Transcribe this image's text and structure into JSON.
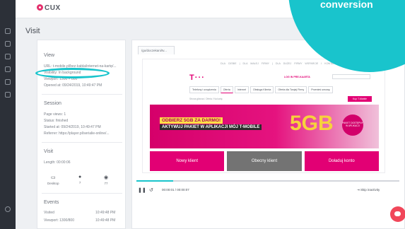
{
  "app": {
    "logo_text": "CUX"
  },
  "page": {
    "title": "Visit"
  },
  "view": {
    "heading": "View",
    "url": "URL: t-mobile.pl/bez-kabla/internet-na-kartę/...",
    "visibility": "Visibility: In background",
    "viewport": "Viewport: 1300 × 800",
    "opened_at": "Opened at: 09/24/2019, 10:49:47 PM"
  },
  "session": {
    "heading": "Session",
    "page_views": "Page views: 1",
    "status": "Status: finished",
    "started_at": "Started at: 09/24/2019, 10:49:47 PM",
    "referrer": "Referrer: https://player.pl/serialie-online/..."
  },
  "visit": {
    "heading": "Visit",
    "length": "Length: 00:00:06",
    "devices": [
      {
        "icon": "desktop-icon",
        "label": "Desktop"
      },
      {
        "icon": "apple-icon",
        "label": "7"
      },
      {
        "icon": "chrome-icon",
        "label": "77"
      }
    ]
  },
  "events": {
    "heading": "Events",
    "rows": [
      {
        "name": "Visited",
        "time": "10:49:48 PM"
      },
      {
        "name": "Viewport: 1300/800",
        "time": "10:49:48 PM"
      }
    ]
  },
  "player": {
    "tab_label": "/go/doczekani/tv...",
    "time": "00:00:01 / 00:00:07",
    "skip_label": "Skip inactivity",
    "progress": 0.14
  },
  "site": {
    "top_links": "DLA CIEBIE  |  DLA MAŁEJ FIRMY  |  DLA DUŻEJ FIRMY    WSPARCIE I KONTAKT    CZAT    NASZE SKLEPY",
    "brand": "T · · ·",
    "account_link": "LOG IN PRE-KAARTA",
    "menu": [
      "Telefony i urządzenia",
      "Oferta",
      "Internet",
      "Obsługa Klienta",
      "Oferta dla Twojej Firmy",
      "Przenieś umowę"
    ],
    "breadcrumb": "Strona główna  /  Oferta  /  Na kartę",
    "cta": "Kup T-Mobile",
    "banner_line1": "ODBIERZ 5GB ZA DARMO!",
    "banner_line2": "AKTYWUJ PAKIET W APLIKACJI MÓJ T-MOBILE",
    "banner_big": "5GB",
    "banner_badge": "PAKIET DOSTĘPNY W APLIKACJI",
    "buttons": [
      "Nowy klient",
      "Obecny klient",
      "Doładuj konto"
    ]
  },
  "overlay": {
    "text": "conversion"
  },
  "colors": {
    "accent_teal": "#19c4cc",
    "brand_magenta": "#e20074",
    "chat": "#f1475a"
  }
}
